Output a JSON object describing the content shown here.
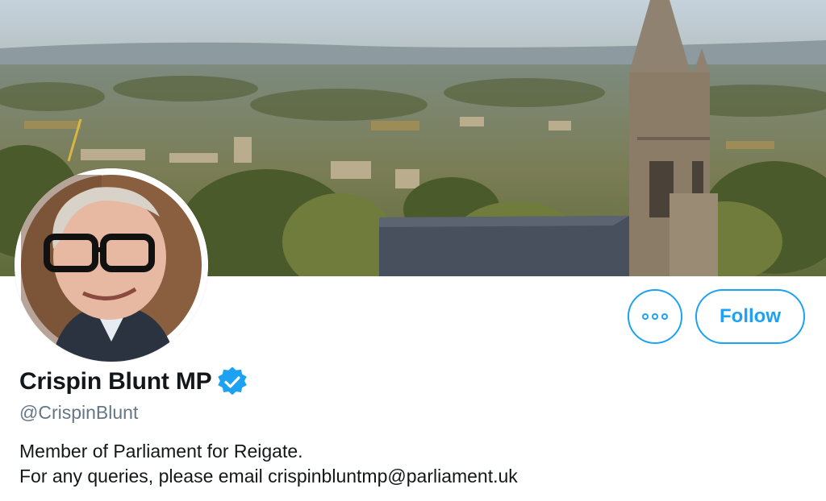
{
  "profile": {
    "display_name": "Crispin Blunt MP",
    "handle": "@CrispinBlunt",
    "verified": true,
    "bio_lines": [
      "Member of Parliament for Reigate.",
      "For any queries, please email crispinbluntmp@parliament.uk"
    ]
  },
  "actions": {
    "follow_label": "Follow",
    "more_icon": "more-dots-icon"
  },
  "colors": {
    "accent": "#1da1f2",
    "text_primary": "#14171a",
    "text_secondary": "#657786"
  }
}
